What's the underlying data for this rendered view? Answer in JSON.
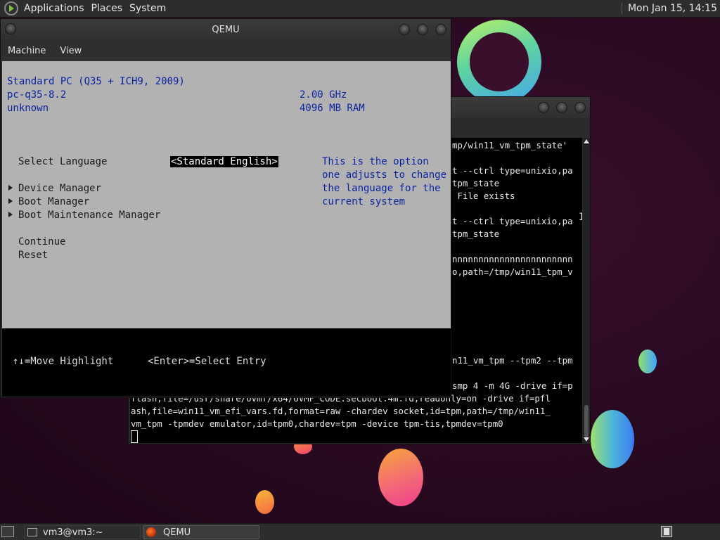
{
  "top_panel": {
    "menus": [
      "Applications",
      "Places",
      "System"
    ],
    "clock": "Mon Jan 15, 14:15"
  },
  "qemu": {
    "title": "QEMU",
    "menu": [
      "Machine",
      "View"
    ],
    "bios": {
      "machine": "Standard PC (Q35 + ICH9, 2009)",
      "version": "pc-q35-8.2",
      "unknown": "unknown",
      "cpu": "2.00 GHz",
      "ram": "4096 MB RAM",
      "select_language_label": "Select Language",
      "language_value": "<Standard English>",
      "help_lines": [
        "This is the option",
        "one adjusts to change",
        "the language for the",
        "current system"
      ],
      "menu_items": [
        "Device Manager",
        "Boot Manager",
        "Boot Maintenance Manager"
      ],
      "continue": "Continue",
      "reset": "Reset",
      "footer_move": "↑↓=Move Highlight",
      "footer_select": "<Enter>=Select Entry"
    }
  },
  "terminal": {
    "lines": [
      "mp/win11_vm_tpm_state'",
      "",
      "t --ctrl type=unixio,pa",
      "tpm_state",
      " File exists",
      "",
      "t --ctrl type=unixio,pa",
      "tpm_state",
      "",
      "nnnnnnnnnnnnnnnnnnnnnnn",
      "o,path=/tmp/win11_tpm_v",
      "",
      "",
      "",
      "",
      "",
      "n11_vm_tpm --tpm2 --tpm",
      "",
      "smp 4 -m 4G -drive if=p",
      "flash,file=/usr/share/ovmf/x64/OVMF_CODE.secboot.4m.fd,readonly=on -drive if=pfl",
      "ash,file=win11_vm_efi_vars.fd,format=raw -chardev socket,id=tpm,path=/tmp/win11_",
      "vm_tpm -tpmdev emulator,id=tpm0,chardev=tpm -device tpm-tis,tpmdev=tpm0"
    ]
  },
  "taskbar": {
    "tasks": [
      "vm3@vm3:~",
      "QEMU"
    ]
  }
}
